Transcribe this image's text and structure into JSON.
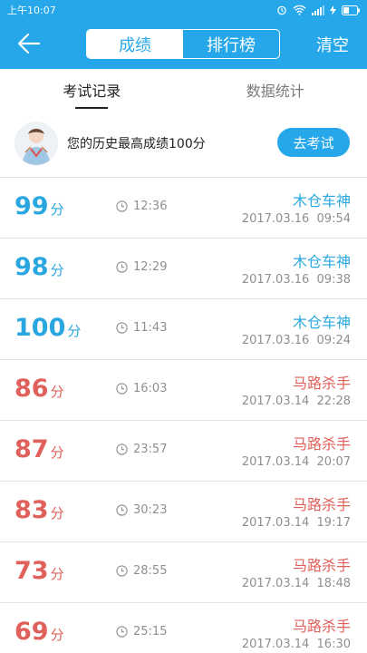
{
  "status_bar": {
    "time": "上午10:07"
  },
  "nav": {
    "tabs": [
      "成绩",
      "排行榜"
    ],
    "active_tab": 0,
    "clear_label": "清空"
  },
  "sub_tabs": [
    "考试记录",
    "数据统计"
  ],
  "best": {
    "text": "您的历史最高成绩100分",
    "button": "去考试"
  },
  "colors": {
    "accent": "#26a7ea",
    "pass": "#2aa7e0",
    "fail": "#e0605b"
  },
  "records": [
    {
      "score": "99",
      "unit": "分",
      "duration": "12:36",
      "rank": "木仓车神",
      "date": "2017.03.16",
      "time": "09:54",
      "pass": true
    },
    {
      "score": "98",
      "unit": "分",
      "duration": "12:29",
      "rank": "木仓车神",
      "date": "2017.03.16",
      "time": "09:38",
      "pass": true
    },
    {
      "score": "100",
      "unit": "分",
      "duration": "11:43",
      "rank": "木仓车神",
      "date": "2017.03.16",
      "time": "09:24",
      "pass": true
    },
    {
      "score": "86",
      "unit": "分",
      "duration": "16:03",
      "rank": "马路杀手",
      "date": "2017.03.14",
      "time": "22:28",
      "pass": false
    },
    {
      "score": "87",
      "unit": "分",
      "duration": "23:57",
      "rank": "马路杀手",
      "date": "2017.03.14",
      "time": "20:07",
      "pass": false
    },
    {
      "score": "83",
      "unit": "分",
      "duration": "30:23",
      "rank": "马路杀手",
      "date": "2017.03.14",
      "time": "19:17",
      "pass": false
    },
    {
      "score": "73",
      "unit": "分",
      "duration": "28:55",
      "rank": "马路杀手",
      "date": "2017.03.14",
      "time": "18:48",
      "pass": false
    },
    {
      "score": "69",
      "unit": "分",
      "duration": "25:15",
      "rank": "马路杀手",
      "date": "2017.03.14",
      "time": "16:30",
      "pass": false
    }
  ]
}
